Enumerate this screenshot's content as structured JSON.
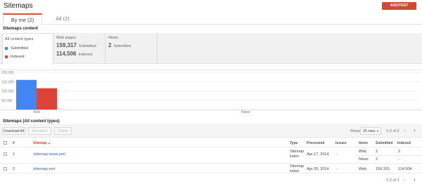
{
  "header": {
    "title": "Sitemaps",
    "add_button": "ADD/TEST SITEMAP"
  },
  "tabs": [
    {
      "label": "By me (2)"
    },
    {
      "label": "All (2)"
    }
  ],
  "content": {
    "heading": "Sitemaps content",
    "types_label": "All content types",
    "legend": [
      {
        "label": "Submitted",
        "color": "#4285f4"
      },
      {
        "label": "Indexed",
        "color": "#db4437"
      }
    ],
    "web": {
      "title": "Web pages",
      "submitted": "159,317",
      "submitted_label": "Submitted",
      "indexed": "114,506",
      "indexed_label": "Indexed"
    },
    "news": {
      "title": "News",
      "submitted": "2",
      "submitted_label": "Submitted"
    }
  },
  "chart_data": {
    "type": "bar",
    "categories": [
      "Web",
      "News"
    ],
    "series": [
      {
        "name": "Submitted",
        "values": [
          159317,
          2
        ],
        "color": "#4285f4"
      },
      {
        "name": "Indexed",
        "values": [
          114506,
          0
        ],
        "color": "#db4437"
      }
    ],
    "yticks": [
      "200,000",
      "150,000",
      "100,000",
      "50,000"
    ],
    "ylim": [
      0,
      200000
    ]
  },
  "table": {
    "heading": "Sitemaps (All content types)",
    "toolbar": {
      "download": "Download All",
      "resubmit": "Resubmit",
      "delete": "Delete"
    },
    "show_label": "Show",
    "rows_select": "25 rows",
    "pager_text": "1-2 of 2",
    "columns": {
      "num": "#",
      "sitemap": "Sitemap",
      "type": "Type",
      "processed": "Processed",
      "issues": "Issues",
      "items": "Items",
      "submitted": "Submitted",
      "indexed": "Indexed"
    },
    "rows": [
      {
        "num": "1",
        "sitemap": "/sitemap-news.xml",
        "type": "Sitemap index",
        "processed": "Apr 17, 2014",
        "issues": "-",
        "items": [
          "Web",
          "News"
        ],
        "submitted": [
          "2",
          "2"
        ],
        "indexed": [
          "2",
          "-"
        ]
      },
      {
        "num": "2",
        "sitemap": "/sitemap.xml",
        "type": "Sitemap index",
        "processed": "Apr 20, 2014",
        "issues": "-",
        "items": [
          "Web"
        ],
        "submitted": [
          "159,315"
        ],
        "indexed": [
          "114,504"
        ]
      }
    ]
  }
}
